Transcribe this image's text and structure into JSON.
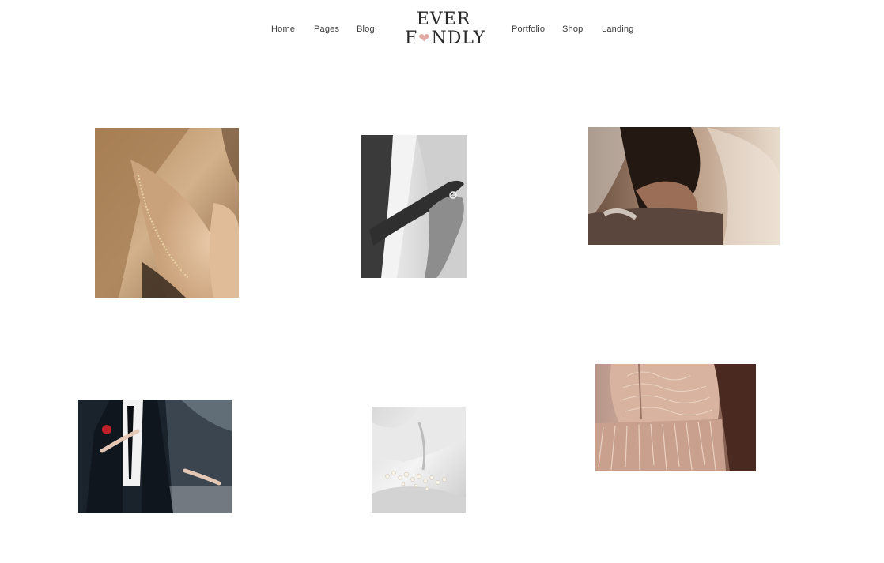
{
  "header": {
    "nav_left": [
      {
        "label": "Home"
      },
      {
        "label": "Pages"
      },
      {
        "label": "Blog"
      }
    ],
    "nav_right": [
      {
        "label": "Portfolio"
      },
      {
        "label": "Shop"
      },
      {
        "label": "Landing"
      }
    ],
    "logo": {
      "line1": "EVER",
      "line2_prefix": "F",
      "line2_suffix": "NDLY",
      "heart_color": "#e3aca6"
    }
  },
  "gallery": {
    "photos": [
      {
        "subject": "bride-neck-necklace",
        "palette": "#c39a6d"
      },
      {
        "subject": "bride-hands-ring-bw",
        "palette": "#9a9a9a"
      },
      {
        "subject": "couple-veil-embrace",
        "palette": "#a5826c"
      },
      {
        "subject": "groom-dancing",
        "palette": "#1f2a36"
      },
      {
        "subject": "hair-accessory-on-fabric",
        "palette": "#dcdcdc"
      },
      {
        "subject": "beaded-dress-detail",
        "palette": "#d5ab96"
      }
    ]
  }
}
